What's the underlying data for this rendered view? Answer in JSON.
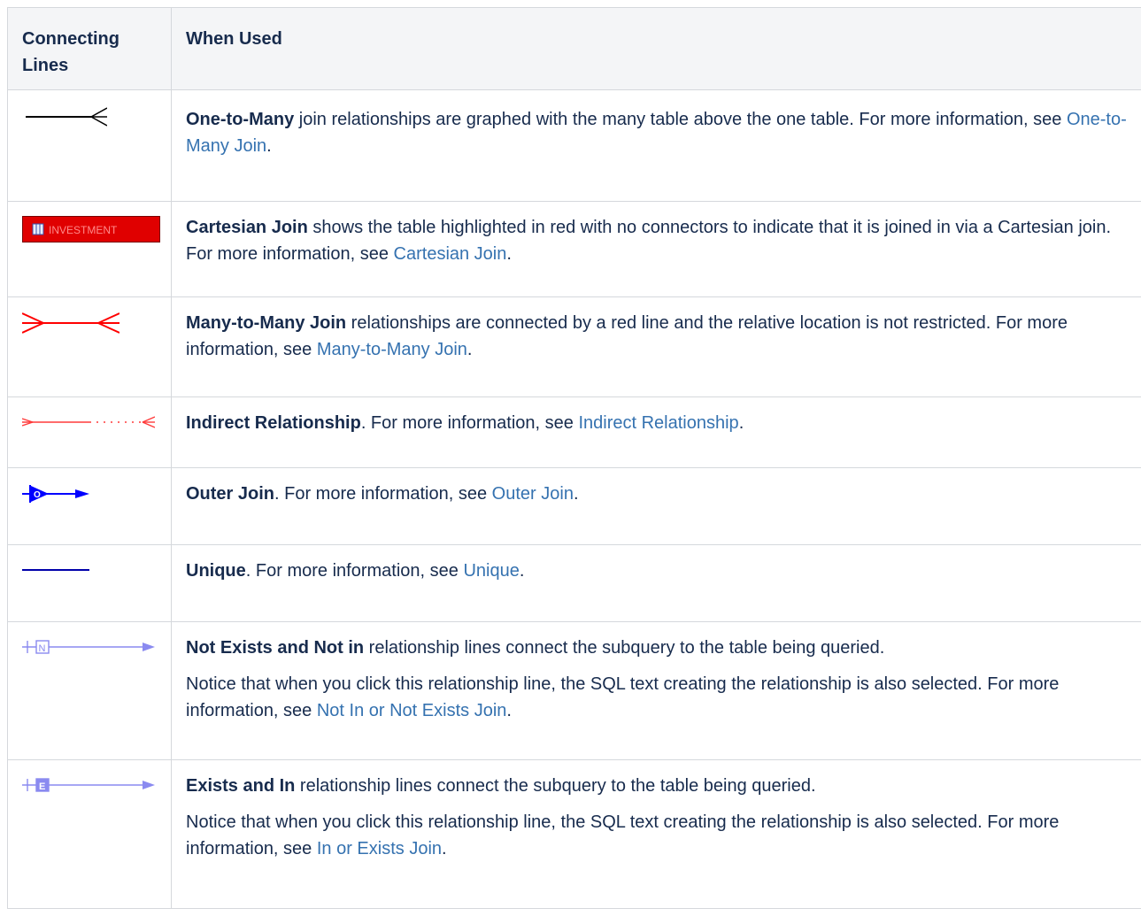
{
  "header": {
    "col1": "Connecting Lines",
    "col2": "When Used"
  },
  "rows": [
    {
      "icon": "one-to-many-icon",
      "title": "One-to-Many",
      "text": " join relationships are graphed with the many table above the one table. For more information, see ",
      "link": "One-to-Many Join",
      "end": "."
    },
    {
      "icon": "cartesian-join-icon",
      "icon_text": "INVESTMENT",
      "title": "Cartesian Join",
      "text": " shows the table highlighted in red with no connectors to indicate that it is joined in via a Cartesian join. For more information, see ",
      "link": "Cartesian Join",
      "end": "."
    },
    {
      "icon": "many-to-many-icon",
      "title": "Many-to-Many Join",
      "text": " relationships are connected by a red line and the relative location is not restricted. For more information, see ",
      "link": "Many-to-Many Join",
      "end": "."
    },
    {
      "icon": "indirect-relationship-icon",
      "title": "Indirect Relationship",
      "text": ". For more information, see ",
      "link": "Indirect Relationship",
      "end": "."
    },
    {
      "icon": "outer-join-icon",
      "icon_text": "O",
      "title": "Outer Join",
      "text": ". For more information, see ",
      "link": "Outer Join",
      "end": "."
    },
    {
      "icon": "unique-icon",
      "title": "Unique",
      "text": ". For more information, see ",
      "link": "Unique",
      "end": "."
    },
    {
      "icon": "not-exists-icon",
      "icon_text": "N",
      "title": "Not Exists and Not in",
      "text": " relationship lines connect the subquery to the table being queried.",
      "note": "Notice that when you click this relationship line, the SQL text creating the relationship is also selected. For more information, see ",
      "link": "Not In or Not Exists Join",
      "end": "."
    },
    {
      "icon": "exists-icon",
      "icon_text": "E",
      "title": "Exists and In",
      "text": " relationship lines connect the subquery to the table being queried.",
      "note": "Notice that when you click this relationship line, the SQL text creating the relationship is also selected. For more information, see ",
      "link": "In or Exists Join",
      "end": "."
    }
  ],
  "colors": {
    "link": "#3572b0",
    "header_bg": "#f4f5f7",
    "border": "#d5d8dc",
    "text": "#172b4d",
    "join_red": "#ff0000",
    "join_blue": "#0000ff",
    "subquery_blue": "#7b7bf0"
  }
}
